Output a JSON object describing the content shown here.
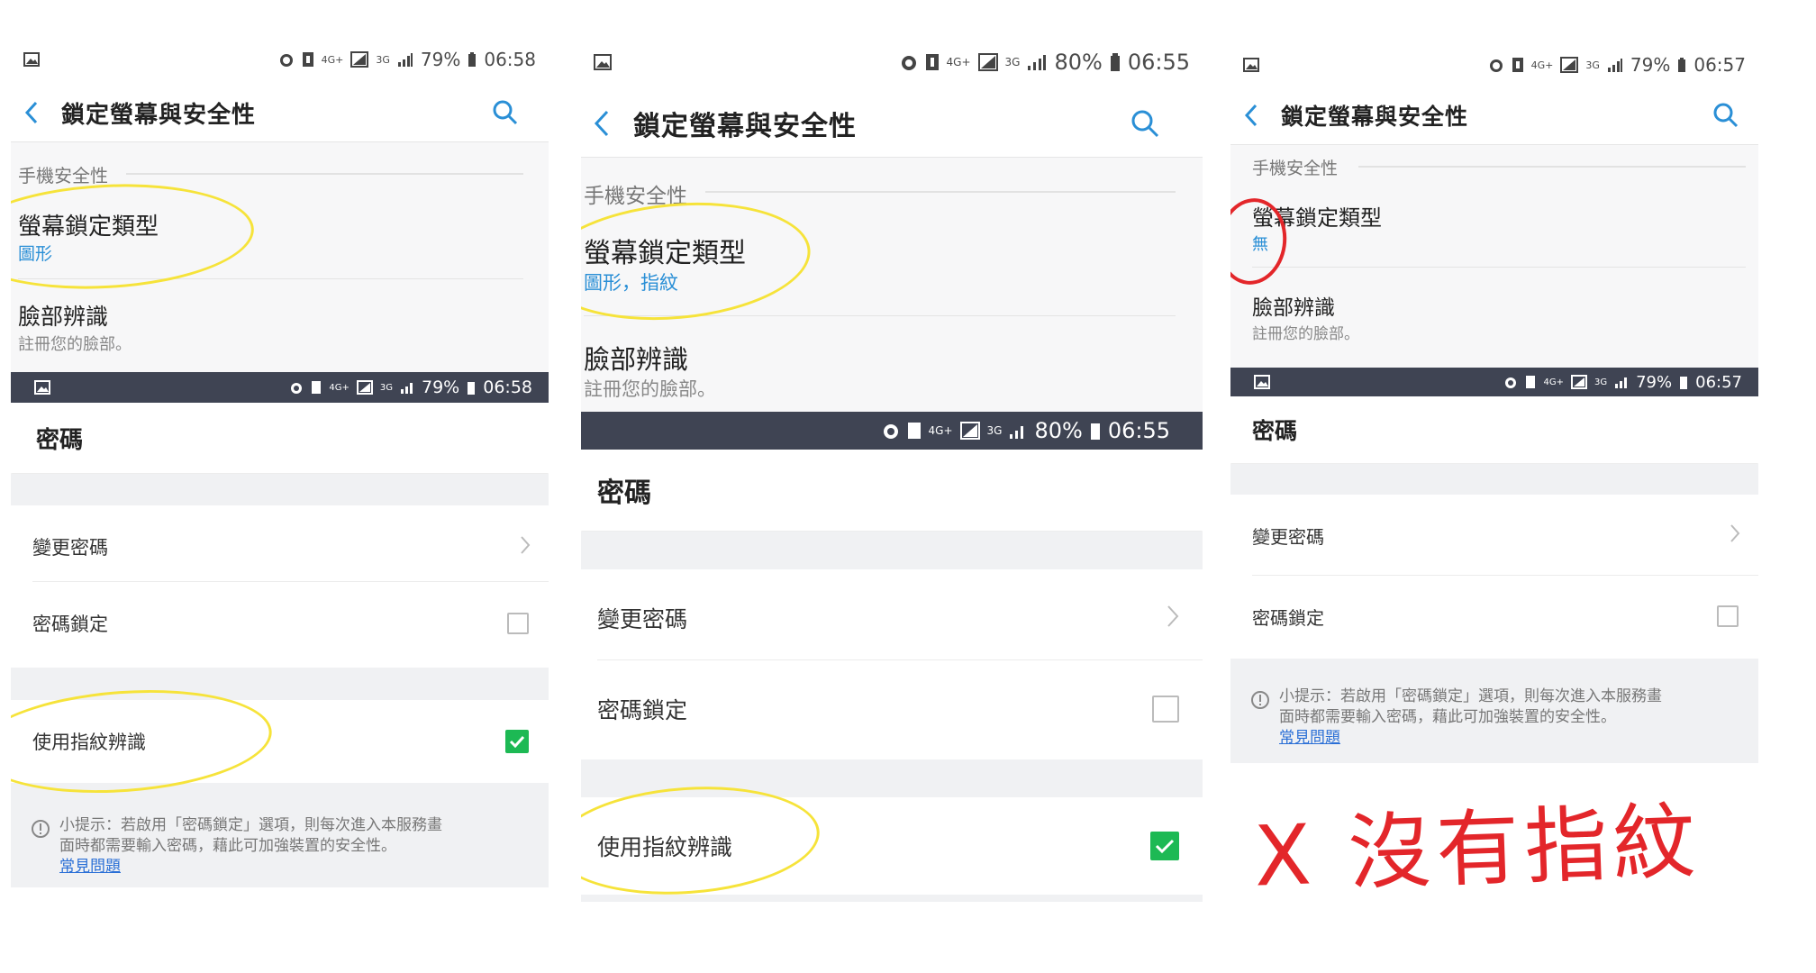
{
  "status_bars": {
    "p1": {
      "battery": "79%",
      "time": "06:58",
      "net1": "4G+",
      "net2": "3G"
    },
    "p2": {
      "battery": "80%",
      "time": "06:55",
      "net1": "4G+",
      "net2": "3G"
    },
    "p3": {
      "battery": "79%",
      "time": "06:57",
      "net1": "4G+",
      "net2": "3G"
    }
  },
  "header": {
    "title": "鎖定螢幕與安全性"
  },
  "section": {
    "phone_security": "手機安全性"
  },
  "screen_lock": {
    "label": "螢幕鎖定類型",
    "value_p1": "圖形",
    "value_p2": "圖形，指紋",
    "value_p3": "無"
  },
  "face": {
    "label": "臉部辨識",
    "sub": "註冊您的臉部。"
  },
  "password_screen": {
    "title": "密碼",
    "change_password": "變更密碼",
    "password_lock": "密碼鎖定",
    "use_fingerprint": "使用指紋辨識",
    "tip": "小提示：若啟用「密碼鎖定」選項，則每次進入本服務畫面時都需要輸入密碼，藉此可加強裝置的安全性。",
    "tip_line1": "小提示：若啟用「密碼鎖定」選項，則每次進入本服務畫",
    "tip_line2": "面時都需要輸入密碼，藉此可加強裝置的安全性。",
    "faq": "常見問題"
  },
  "annotation": {
    "note": "X 沒有指紋",
    "note_color": "#e3262a",
    "highlight_color": "#f6e33a"
  },
  "colors": {
    "accent": "#2a8fd6",
    "check": "#1db954",
    "dark_bar": "#3f4453"
  }
}
